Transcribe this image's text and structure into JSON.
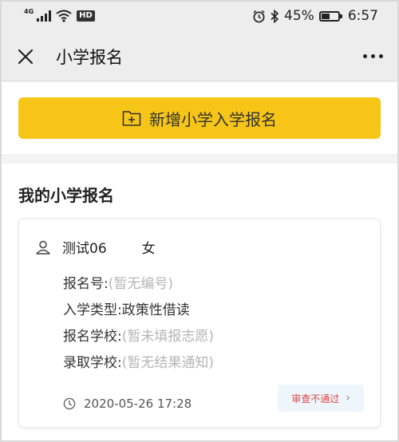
{
  "status_bar": {
    "signal_label": "4G",
    "hd_badge": "HD",
    "battery_percent": "45%",
    "battery_level": 0.45,
    "time": "6:57",
    "icons": [
      "signal-icon",
      "wifi-icon",
      "hd-icon",
      "alarm-icon",
      "bluetooth-icon",
      "battery-icon"
    ]
  },
  "nav": {
    "title": "小学报名",
    "close_icon": "close-icon",
    "more_icon": "more-icon"
  },
  "add_button": {
    "label": "新增小学入学报名",
    "icon": "folder-plus-icon",
    "color": "#f7c518"
  },
  "my_section": {
    "title": "我的小学报名",
    "records": [
      {
        "name": "测试06",
        "gender": "女",
        "fields": [
          {
            "label": "报名号:",
            "value": "(暂无编号)"
          },
          {
            "label": "入学类型:",
            "value": "政策性借读"
          },
          {
            "label": "报名学校:",
            "value": "(暂未填报志愿)"
          },
          {
            "label": "录取学校:",
            "value": "(暂无结果通知)"
          }
        ],
        "time": "2020-05-26 17:28",
        "status": "审查不通过",
        "status_color": "#e04545"
      }
    ]
  }
}
